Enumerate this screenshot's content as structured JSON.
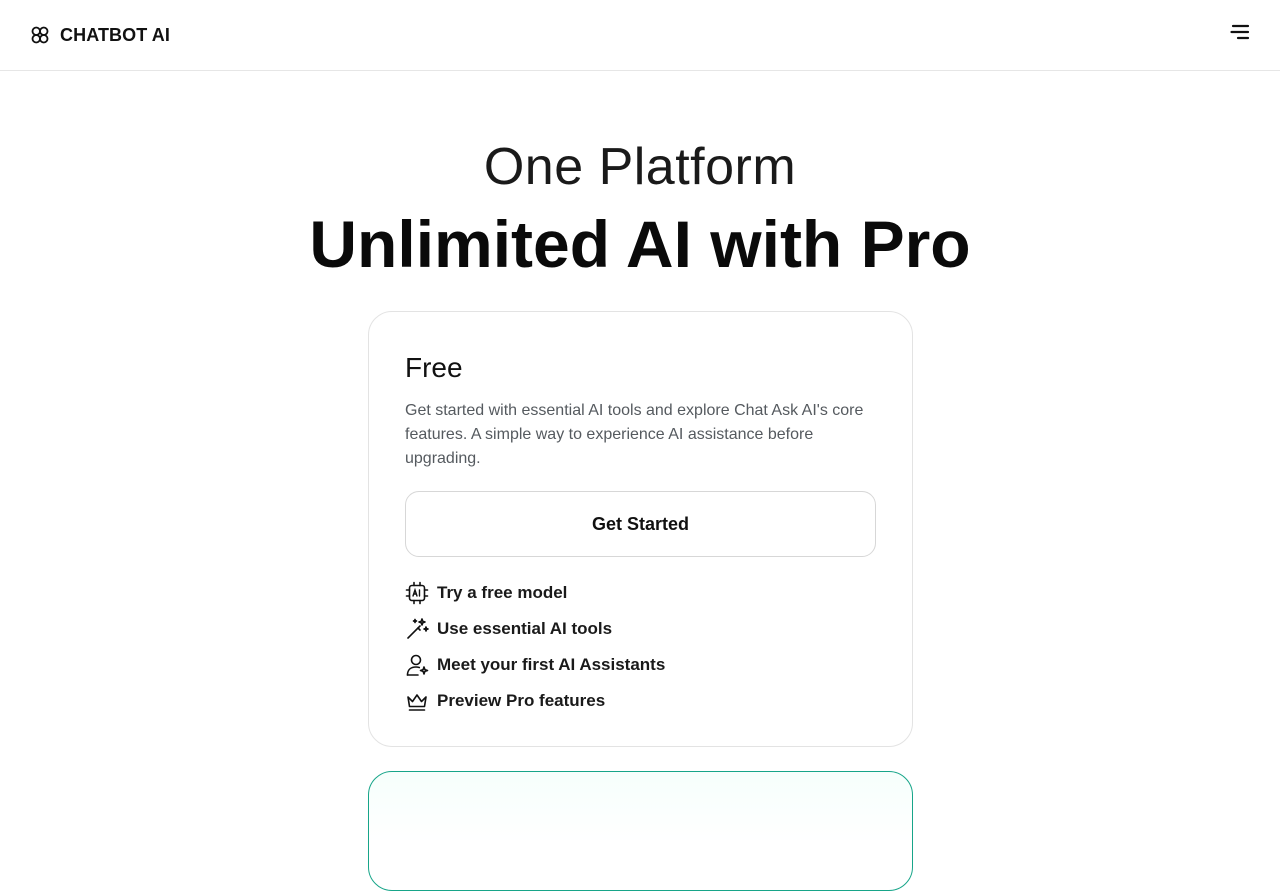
{
  "header": {
    "brand_name": "CHATBOT AI",
    "brand_icon": "knot-logo-icon",
    "menu_icon": "hamburger-menu-icon"
  },
  "hero": {
    "line1": "One Platform",
    "line2": "Unlimited AI with Pro"
  },
  "plans": [
    {
      "title": "Free",
      "description": "Get started with essential AI tools and explore Chat Ask AI's core features. A simple way to experience AI assistance before upgrading.",
      "cta_label": "Get Started",
      "features": [
        {
          "icon": "ai-chip-icon",
          "label": "Try a free model"
        },
        {
          "icon": "magic-wand-icon",
          "label": "Use essential AI tools"
        },
        {
          "icon": "user-sparkle-icon",
          "label": "Meet your first AI Assistants"
        },
        {
          "icon": "crown-icon",
          "label": "Preview Pro features"
        }
      ]
    }
  ],
  "colors": {
    "accent_border": "#17a589",
    "text": "#111111",
    "muted_text": "#555a5f",
    "divider": "#e6e6e6"
  }
}
